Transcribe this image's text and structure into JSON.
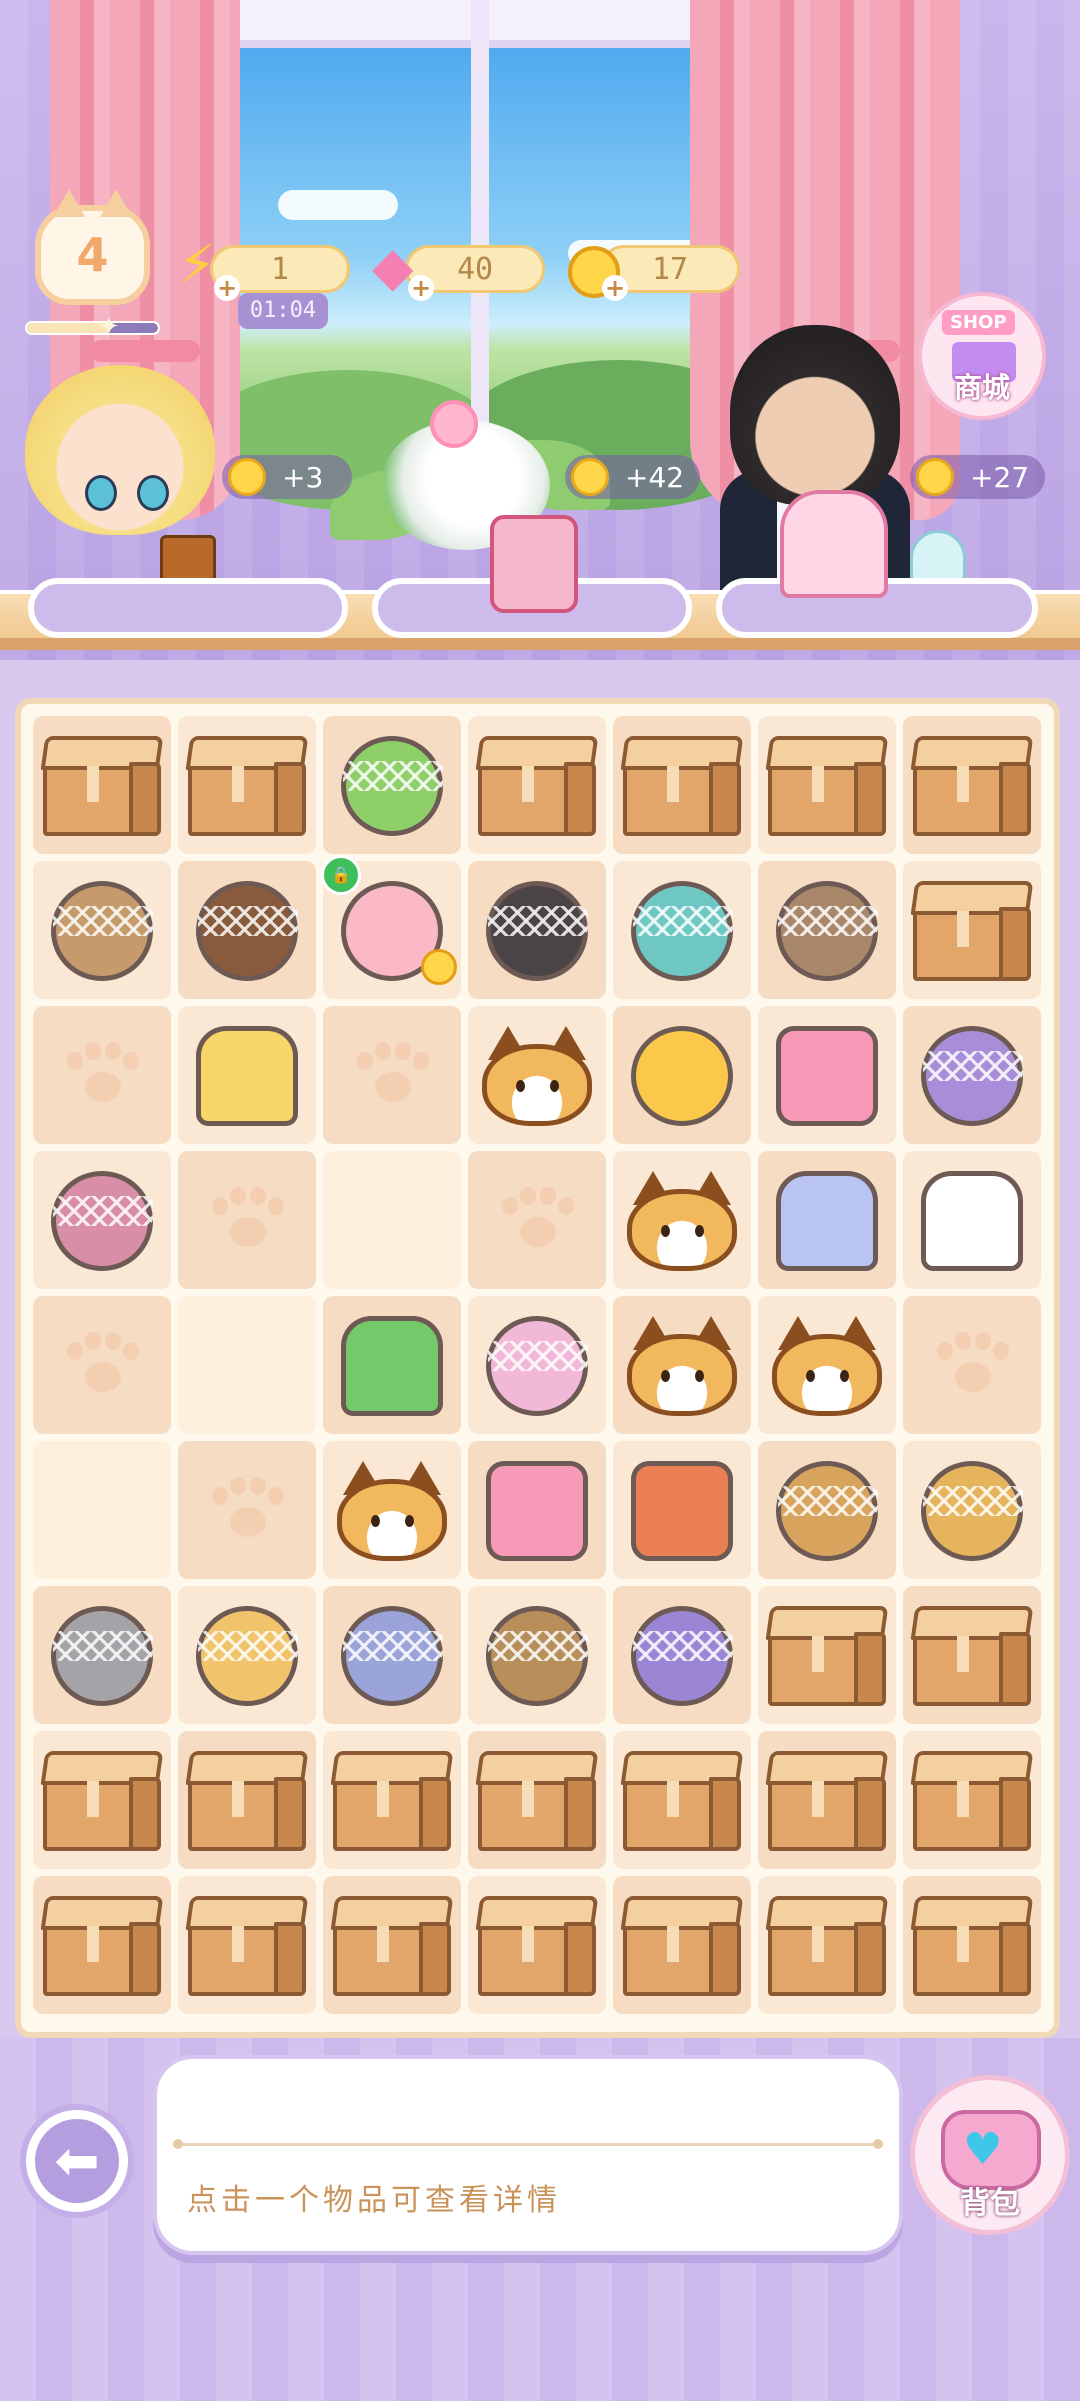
{
  "hud": {
    "level": "4",
    "level_progress": 0.62,
    "energy": "1",
    "energy_timer": "01:04",
    "gems": "40",
    "coins": "17"
  },
  "shop": {
    "sign": "SHOP",
    "label": "商城"
  },
  "customers": [
    {
      "name": "blond-boy",
      "reward": "+3"
    },
    {
      "name": "white-cat-spirit",
      "reward": "+42"
    },
    {
      "name": "dark-hair-man",
      "reward": "+27"
    }
  ],
  "board": {
    "rows": [
      [
        "box",
        "box",
        "watering-can-webbed",
        "box",
        "box",
        "box",
        "box"
      ],
      [
        "tulip-webbed",
        "pot-webbed",
        "piggy-bank-locked",
        "black-cat-webbed",
        "pet-bowl-webbed",
        "shovel-webbed",
        "box"
      ],
      [
        "paw-empty",
        "yellow-dress",
        "paw-empty",
        "cat-token",
        "tea-cup",
        "pink-cushion",
        "bouquet-webbed"
      ],
      [
        "robe-webbed",
        "paw-empty",
        "empty",
        "paw-empty",
        "cat-token",
        "pastel-jacket",
        "white-dress"
      ],
      [
        "paw-empty",
        "empty",
        "green-sweater",
        "clothes-rack-webbed",
        "cat-token",
        "cat-token",
        "paw-empty"
      ],
      [
        "empty",
        "paw-empty",
        "cat-token",
        "pink-cushion",
        "coffee-machine",
        "cake-webbed",
        "fruit-cake-webbed"
      ],
      [
        "gray-hair-webbed",
        "strawberry-cake-webbed",
        "scrunchie-webbed",
        "brown-hat-webbed",
        "purple-item-webbed",
        "box",
        "box"
      ],
      [
        "box",
        "box",
        "box",
        "box",
        "box",
        "box",
        "box"
      ],
      [
        "box",
        "box",
        "box",
        "box",
        "box",
        "box",
        "box"
      ]
    ]
  },
  "info_panel": {
    "hint": "点击一个物品可查看详情"
  },
  "bag": {
    "label": "背包"
  }
}
